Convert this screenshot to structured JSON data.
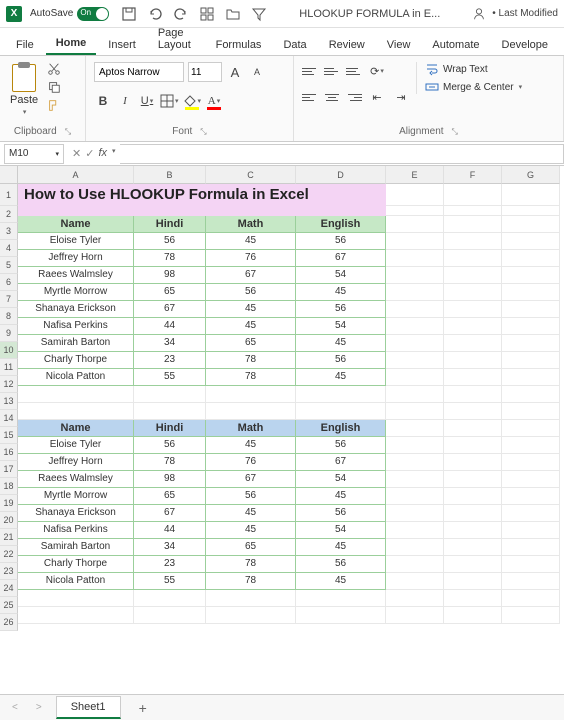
{
  "titlebar": {
    "autosave_label": "AutoSave",
    "autosave_state": "On",
    "filename": "HLOOKUP FORMULA in E...",
    "last_modified": "Last Modified"
  },
  "tabs": [
    "File",
    "Home",
    "Insert",
    "Page Layout",
    "Formulas",
    "Data",
    "Review",
    "View",
    "Automate",
    "Develope"
  ],
  "active_tab": "Home",
  "ribbon": {
    "clipboard": {
      "label": "Clipboard",
      "paste": "Paste"
    },
    "font": {
      "label": "Font",
      "name": "Aptos Narrow",
      "size": "11",
      "increase": "A",
      "decrease": "A",
      "bold": "B",
      "italic": "I",
      "underline": "U"
    },
    "alignment": {
      "label": "Alignment",
      "wrap": "Wrap Text",
      "merge": "Merge & Center"
    }
  },
  "namebox": "M10",
  "formula": "",
  "columns": [
    "A",
    "B",
    "C",
    "D",
    "E",
    "F",
    "G"
  ],
  "title": "How to Use HLOOKUP Formula in Excel",
  "headers": [
    "Name",
    "Hindi",
    "Math",
    "English"
  ],
  "table": [
    {
      "name": "Eloise Tyler",
      "hindi": 56,
      "math": 45,
      "english": 56
    },
    {
      "name": "Jeffrey Horn",
      "hindi": 78,
      "math": 76,
      "english": 67
    },
    {
      "name": "Raees Walmsley",
      "hindi": 98,
      "math": 67,
      "english": 54
    },
    {
      "name": "Myrtle Morrow",
      "hindi": 65,
      "math": 56,
      "english": 45
    },
    {
      "name": "Shanaya Erickson",
      "hindi": 67,
      "math": 45,
      "english": 56
    },
    {
      "name": "Nafisa Perkins",
      "hindi": 44,
      "math": 45,
      "english": 54
    },
    {
      "name": "Samirah Barton",
      "hindi": 34,
      "math": 65,
      "english": 45
    },
    {
      "name": "Charly Thorpe",
      "hindi": 23,
      "math": 78,
      "english": 56
    },
    {
      "name": "Nicola Patton",
      "hindi": 55,
      "math": 78,
      "english": 45
    }
  ],
  "sheet": {
    "name": "Sheet1"
  }
}
